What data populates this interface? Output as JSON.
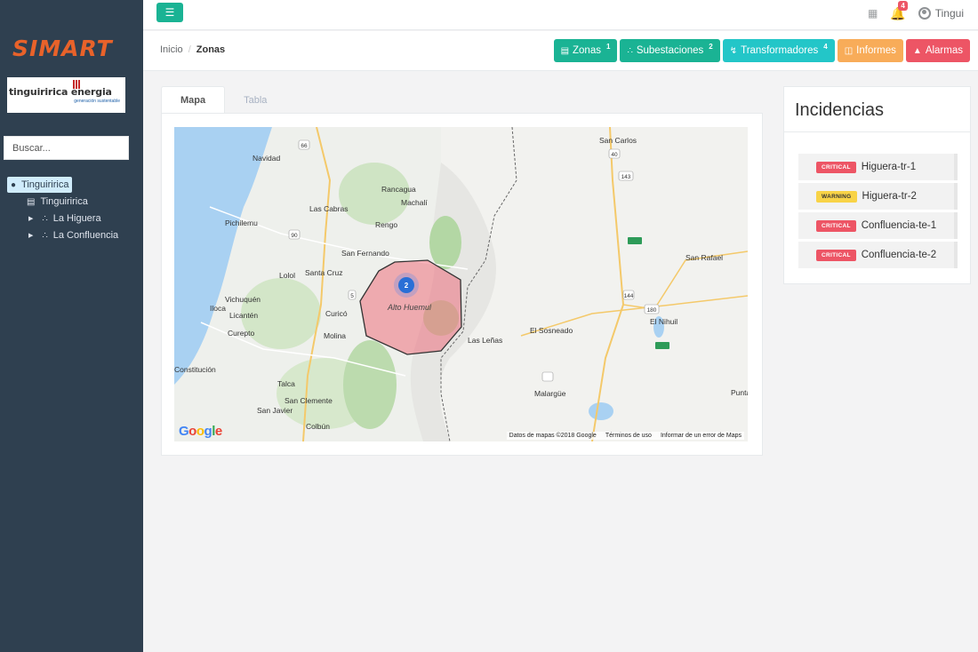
{
  "sidebar": {
    "logo": "SIMART",
    "company_logo": "tinguiririca energia",
    "company_tagline": "generación sustentable",
    "search_placeholder": "Buscar...",
    "tree": [
      {
        "label": "Tinguiririca",
        "icon": "globe-icon",
        "selected": true
      },
      {
        "label": "Tinguiririca",
        "icon": "bank-icon"
      },
      {
        "label": "La Higuera",
        "icon": "sitemap-icon"
      },
      {
        "label": "La Confluencia",
        "icon": "sitemap-icon"
      }
    ]
  },
  "topbar": {
    "menu_icon": "hamburger-icon",
    "notifications_count": "4",
    "user_name": "Tingui"
  },
  "breadcrumb": {
    "home": "Inicio",
    "current": "Zonas"
  },
  "actions": [
    {
      "label": "Zonas",
      "count": "1",
      "icon": "bank-icon",
      "color": "#1ab394"
    },
    {
      "label": "Subestaciones",
      "count": "2",
      "icon": "sitemap-icon",
      "color": "#1ab394"
    },
    {
      "label": "Transformadores",
      "count": "4",
      "icon": "bolt-icon",
      "color": "#23c6c8"
    },
    {
      "label": "Informes",
      "icon": "file-icon",
      "color": "#f8ac59"
    },
    {
      "label": "Alarmas",
      "icon": "bell-icon",
      "color": "#ed5565"
    }
  ],
  "tabs": [
    {
      "label": "Mapa",
      "active": true
    },
    {
      "label": "Tabla",
      "active": false
    }
  ],
  "map": {
    "zone_label": "Alto Huemul",
    "cluster_count": "2",
    "places": [
      "San Carlos",
      "Navidad",
      "Rancagua",
      "Machalí",
      "Las Cabras",
      "Pichilemu",
      "Rengo",
      "San Fernando",
      "San Rafael",
      "Lolol",
      "Santa Cruz",
      "Vichuquén",
      "Iloca",
      "Licantén",
      "Curicó",
      "Curepto",
      "Molina",
      "Las Leñas",
      "El Sosneado",
      "El Nihuil",
      "Constitución",
      "Talca",
      "San Clemente",
      "San Javier",
      "Colbún",
      "Malargüe",
      "Punta del Agua"
    ],
    "roads": [
      "66",
      "40",
      "143",
      "90",
      "5",
      "144",
      "180"
    ],
    "footer": [
      "Datos de mapas ©2018 Google",
      "Términos de uso",
      "Informar de un error de Maps"
    ]
  },
  "incidencias": {
    "title": "Incidencias",
    "items": [
      {
        "level": "CRITICAL",
        "name": "Higuera-tr-1"
      },
      {
        "level": "WARNING",
        "name": "Higuera-tr-2"
      },
      {
        "level": "CRITICAL",
        "name": "Confluencia-te-1"
      },
      {
        "level": "CRITICAL",
        "name": "Confluencia-te-2"
      }
    ]
  },
  "colors": {
    "primary": "#1ab394",
    "info": "#23c6c8",
    "warning": "#f8ac59",
    "danger": "#ed5565",
    "sidebar": "#2f4050"
  }
}
